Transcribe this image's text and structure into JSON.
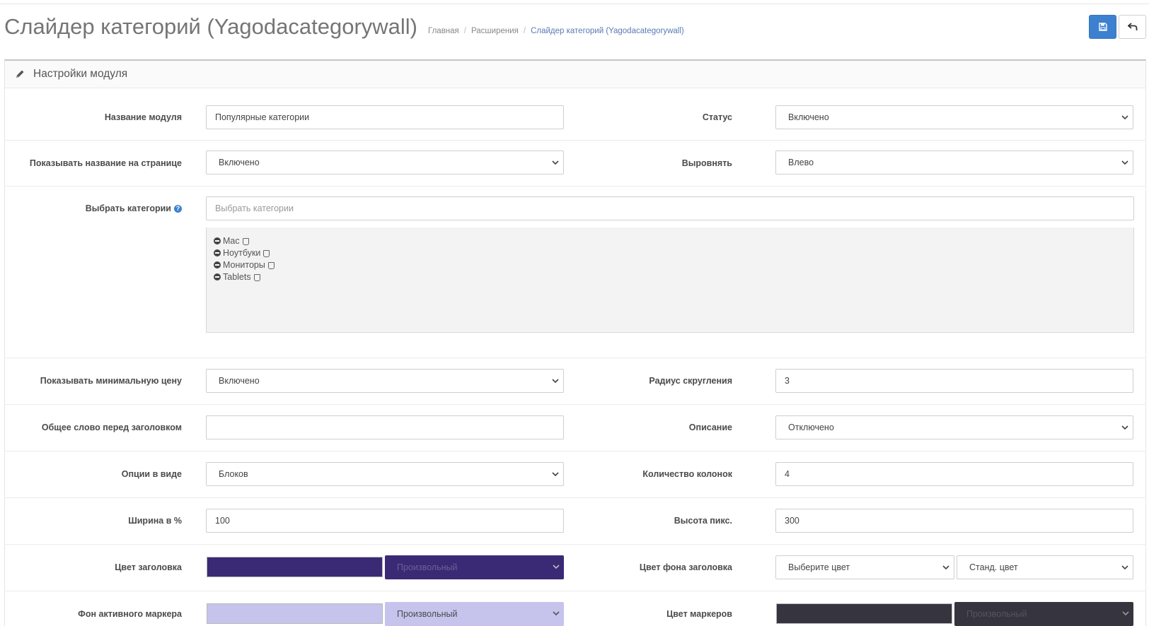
{
  "header": {
    "title": "Слайдер категорий (Yagodacategorywall)",
    "breadcrumb": [
      "Главная",
      "Расширения",
      "Слайдер категорий (Yagodacategorywall)"
    ]
  },
  "buttons": {
    "save_icon": "save-icon",
    "back_icon": "back-arrow-icon"
  },
  "panel": {
    "title": "Настройки модуля",
    "icon": "pencil-icon"
  },
  "form": {
    "module_name": {
      "label": "Название модуля",
      "value": "Популярные категории"
    },
    "status": {
      "label": "Статус",
      "value": "Включено"
    },
    "show_name": {
      "label": "Показывать название на странице",
      "value": "Включено"
    },
    "align": {
      "label": "Выровнять",
      "value": "Влево"
    },
    "categories": {
      "label": "Выбрать категории",
      "help": "?",
      "placeholder": "Выбрать категории",
      "items": [
        "Mac",
        "Ноутбуки",
        "Мониторы",
        "Tablets"
      ]
    },
    "min_price": {
      "label": "Показывать минимальную цену",
      "value": "Включено"
    },
    "radius": {
      "label": "Радиус скругления",
      "value": "3"
    },
    "common_word": {
      "label": "Общее слово перед заголовком",
      "value": ""
    },
    "description": {
      "label": "Описание",
      "value": "Отключено"
    },
    "options_view": {
      "label": "Опции в виде",
      "value": "Блоков"
    },
    "columns": {
      "label": "Количество колонок",
      "value": "4"
    },
    "width": {
      "label": "Ширина в %",
      "value": "100"
    },
    "height": {
      "label": "Высота пикс.",
      "value": "300"
    },
    "title_color": {
      "label": "Цвет заголовка",
      "swatch": "#3a2a75",
      "mode": "Произвольный",
      "mode_bg": "#3a2a75",
      "mode_text": "#6a5f96"
    },
    "title_bg_color": {
      "label": "Цвет фона заголовка",
      "picker": "Выберите цвет",
      "mode": "Станд. цвет"
    },
    "active_marker_bg": {
      "label": "Фон активного маркера",
      "swatch": "#c6c3ed",
      "mode": "Произвольный",
      "mode_bg": "#c6c3ed",
      "mode_text": "#4b4b4b"
    },
    "marker_color": {
      "label": "Цвет маркеров",
      "swatch": "#36343e",
      "mode": "Произвольный",
      "mode_bg": "#36343e",
      "mode_text": "#55535c"
    }
  },
  "colors": {
    "primary": "#3d80d0",
    "link": "#5a7ab3"
  }
}
